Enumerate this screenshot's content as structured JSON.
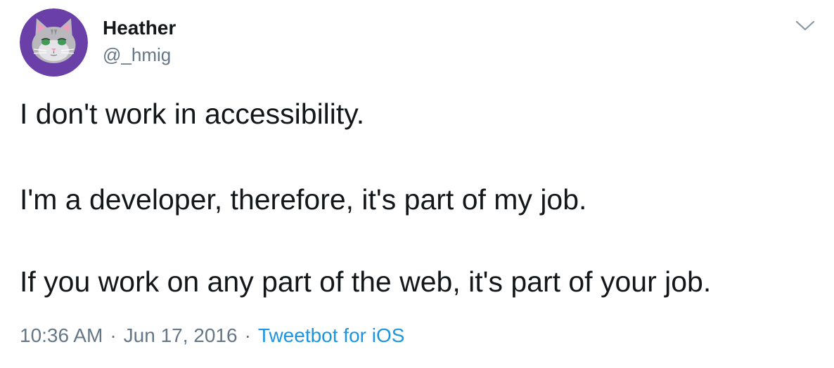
{
  "user": {
    "display_name": "Heather",
    "handle": "@_hmig",
    "avatar_icon": "cat-avatar-icon",
    "avatar_bg": "#6a3fa8"
  },
  "menu": {
    "icon": "chevron-down-icon"
  },
  "tweet": {
    "lines": [
      "I don't work in accessibility.",
      "I'm a developer, therefore, it's part of my job.",
      "If you work on any part of the web, it's part of your job."
    ]
  },
  "meta": {
    "time": "10:36 AM",
    "separator": "·",
    "date": "Jun 17, 2016",
    "source": "Tweetbot for iOS"
  },
  "colors": {
    "text": "#14171a",
    "secondary": "#657786",
    "link": "#1b95e0"
  }
}
